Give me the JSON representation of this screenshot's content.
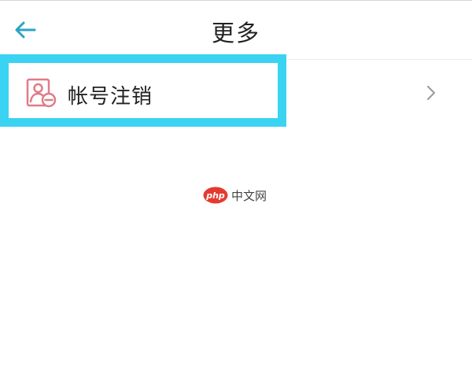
{
  "header": {
    "title": "更多",
    "back_icon": "arrow-left-icon",
    "back_icon_color": "#29a3c6"
  },
  "menu": {
    "items": [
      {
        "label": "帐号注销",
        "icon": "account-remove-icon",
        "icon_color": "#e07b87",
        "trailing_icon": "chevron-right-icon"
      }
    ]
  },
  "highlight": {
    "color": "#3ad3f2"
  },
  "watermark": {
    "logo_text": "php",
    "text": "中文网",
    "logo_color": "#e33b2f"
  }
}
